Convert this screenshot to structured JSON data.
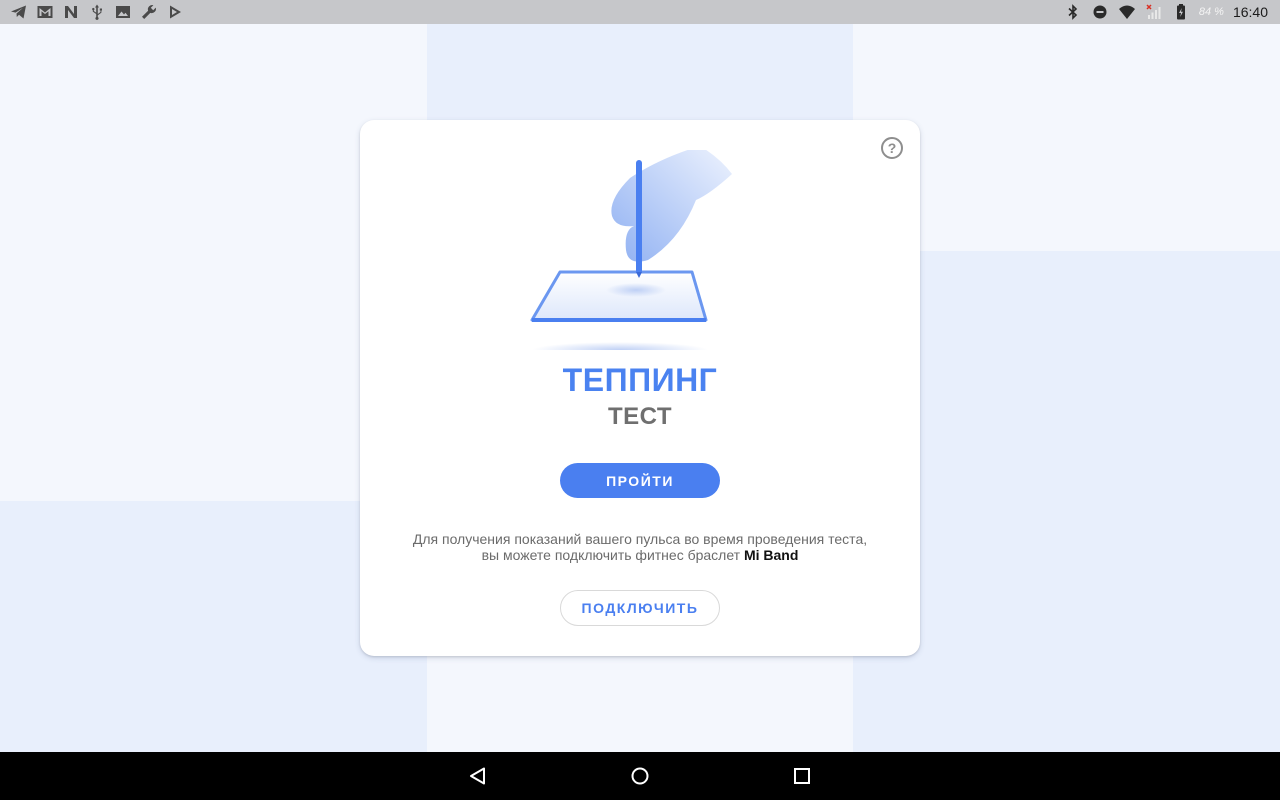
{
  "status_bar": {
    "left_icons": [
      "telegram-icon",
      "gmail-icon",
      "n-app-icon",
      "usb-icon",
      "image-icon",
      "wrench-icon",
      "play-store-icon"
    ],
    "right_icons": [
      "bluetooth-icon",
      "dnd-icon",
      "wifi-icon",
      "no-signal-icon",
      "battery-charging-icon"
    ],
    "battery": "84 %",
    "time": "16:40"
  },
  "card": {
    "help_icon": "help-icon",
    "help_glyph": "?",
    "title": "ТЕППИНГ",
    "subtitle": "ТЕСТ",
    "start_button": "ПРОЙТИ",
    "info_line1": "Для получения показаний вашего пульса во время проведения теста,",
    "info_line2": "вы можете подключить фитнес браслет",
    "info_brand": "Mi Band",
    "connect_button": "ПОДКЛЮЧИТЬ"
  },
  "navigation": {
    "back": "back-icon",
    "home": "home-icon",
    "recents": "recents-icon"
  },
  "colors": {
    "accent": "#4a7ff0",
    "title": "#4a82f0",
    "subtitle": "#6f6f6f",
    "background_light": "#f4f7fd",
    "background_tint": "#e8effc"
  }
}
